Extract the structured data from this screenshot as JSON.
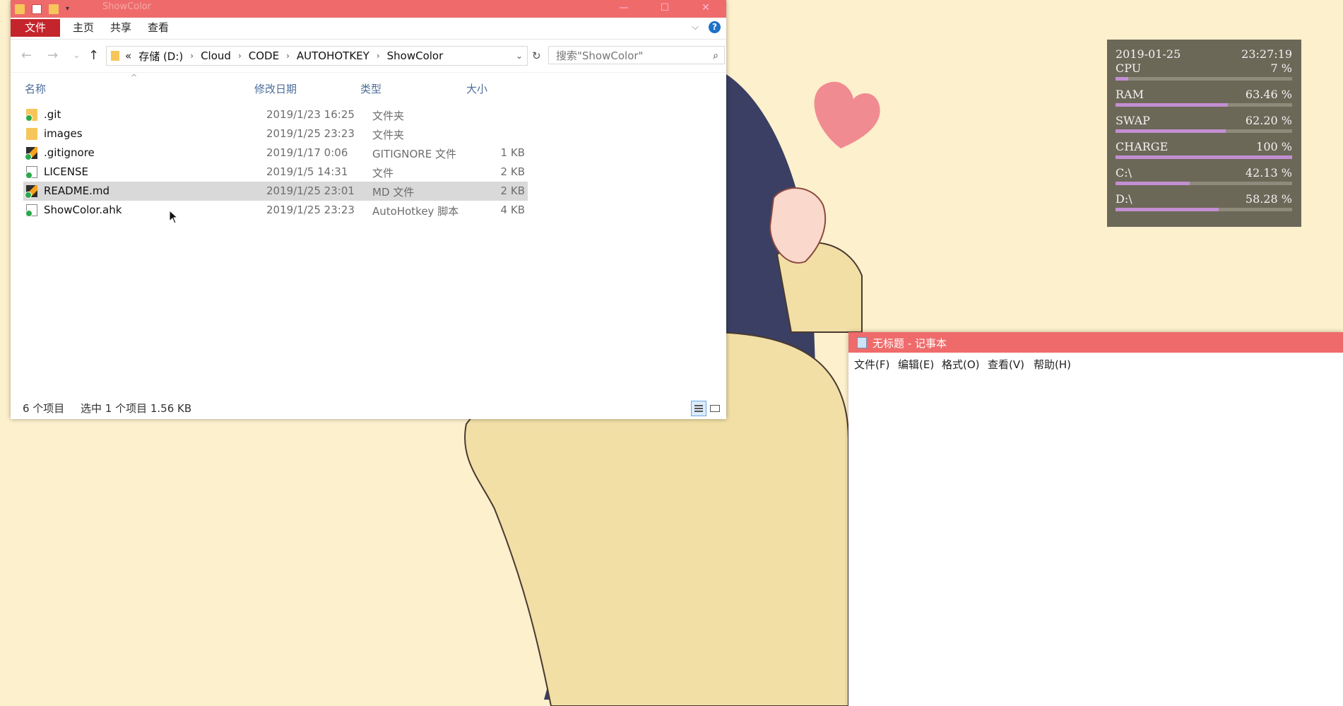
{
  "explorer": {
    "title": "ShowColor",
    "qat": {
      "dropdown_glyph": "▾"
    },
    "window_buttons": {
      "minimize": "—",
      "maximize": "☐",
      "close": "✕"
    },
    "ribbon": {
      "tabs": [
        "文件",
        "主页",
        "共享",
        "查看"
      ],
      "expand_glyph": "⌵",
      "help_glyph": "?"
    },
    "nav": {
      "back": "←",
      "forward": "→",
      "recent": "⌄",
      "up": "↑",
      "address_prefix": "«",
      "breadcrumb": [
        "存储 (D:)",
        "Cloud",
        "CODE",
        "AUTOHOTKEY",
        "ShowColor"
      ],
      "sep_glyph": "›",
      "dropdown_glyph": "⌄",
      "refresh_glyph": "↻",
      "search_placeholder": "搜索\"ShowColor\"",
      "search_glyph": "⌕"
    },
    "columns": {
      "name": "名称",
      "date": "修改日期",
      "type": "类型",
      "size": "大小",
      "sort_glyph": "^"
    },
    "files": [
      {
        "name": ".git",
        "date": "2019/1/23 16:25",
        "type": "文件夹",
        "size": "",
        "icon": "git-folder-icon"
      },
      {
        "name": "images",
        "date": "2019/1/25 23:23",
        "type": "文件夹",
        "size": "",
        "icon": "folder-icon"
      },
      {
        "name": ".gitignore",
        "date": "2019/1/17 0:06",
        "type": "GITIGNORE 文件",
        "size": "1 KB",
        "icon": "sublime-file-icon"
      },
      {
        "name": "LICENSE",
        "date": "2019/1/5 14:31",
        "type": "文件",
        "size": "2 KB",
        "icon": "file-icon"
      },
      {
        "name": "README.md",
        "date": "2019/1/25 23:01",
        "type": "MD 文件",
        "size": "2 KB",
        "icon": "sublime-file-icon"
      },
      {
        "name": "ShowColor.ahk",
        "date": "2019/1/25 23:23",
        "type": "AutoHotkey 脚本",
        "size": "4 KB",
        "icon": "ahk-file-icon"
      }
    ],
    "status": {
      "count": "6 个项目",
      "selection": "选中 1 个项目  1.56 KB"
    }
  },
  "sysmon": {
    "date": "2019-01-25",
    "time": "23:27:19",
    "bar_color": "#c38fd2",
    "rows": [
      {
        "label": "CPU",
        "value": "7 %",
        "percent": 7
      },
      {
        "label": "RAM",
        "value": "63.46 %",
        "percent": 63.46
      },
      {
        "label": "SWAP",
        "value": "62.20 %",
        "percent": 62.2
      },
      {
        "label": "CHARGE",
        "value": "100 %",
        "percent": 100
      },
      {
        "label": "C:\\",
        "value": "42.13 %",
        "percent": 42.13
      },
      {
        "label": "D:\\",
        "value": "58.28 %",
        "percent": 58.28
      }
    ]
  },
  "notepad": {
    "title": "无标题 - 记事本",
    "menu": [
      "文件(F)",
      "编辑(E)",
      "格式(O)",
      "查看(V)",
      "帮助(H)"
    ]
  },
  "colors": {
    "titlebar": "#ef6b6b",
    "file_tab": "#c4242b",
    "desktop": "#fdf0cc"
  }
}
